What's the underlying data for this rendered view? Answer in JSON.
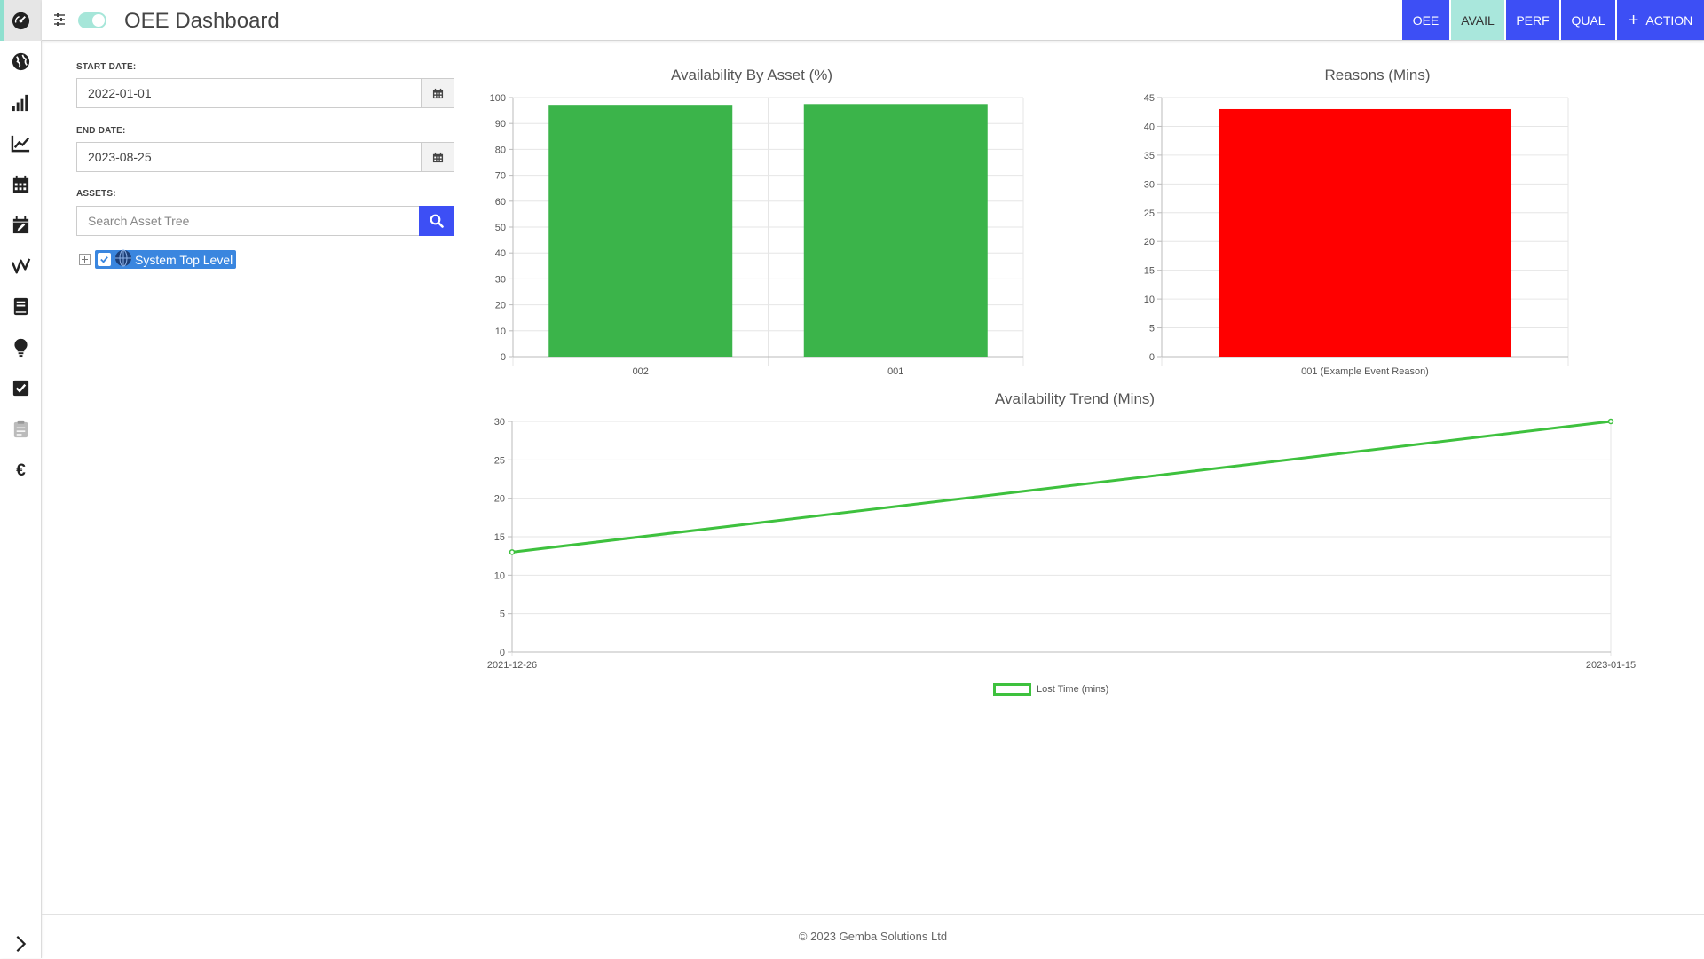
{
  "header": {
    "title": "OEE Dashboard",
    "tabs": [
      {
        "label": "OEE",
        "active": false
      },
      {
        "label": "AVAIL",
        "active": true
      },
      {
        "label": "PERF",
        "active": false
      },
      {
        "label": "QUAL",
        "active": false
      }
    ],
    "action_label": "ACTION"
  },
  "sidebar": {
    "items": [
      "dashboard-icon",
      "globe-icon",
      "signal-bars-icon",
      "line-chart-icon",
      "calendar-icon",
      "calendar-edit-icon",
      "trend-icon",
      "book-icon",
      "lightbulb-icon",
      "checkbox-icon",
      "clipboard-icon",
      "euro-icon"
    ],
    "expand_icon": "chevron-right-icon"
  },
  "filters": {
    "start_label": "START DATE:",
    "start_value": "2022-01-01",
    "end_label": "END DATE:",
    "end_value": "2023-08-25",
    "assets_label": "ASSETS:",
    "search_placeholder": "Search Asset Tree",
    "tree_root": "System Top Level"
  },
  "colors": {
    "accent": "#3d4ff5",
    "active_tab": "#a9e7dc",
    "bar_green": "#3bb44a",
    "bar_red": "#ff0000",
    "line_green": "#3ec13e",
    "tree_selected": "#3a86df"
  },
  "chart_data": [
    {
      "type": "bar",
      "title": "Availability By Asset (%)",
      "categories": [
        "002",
        "001"
      ],
      "values": [
        97.2,
        97.5
      ],
      "ylim": [
        0,
        100
      ],
      "yticks": [
        0,
        10,
        20,
        30,
        40,
        50,
        60,
        70,
        80,
        90,
        100
      ],
      "color": "#3bb44a"
    },
    {
      "type": "bar",
      "title": "Reasons (Mins)",
      "categories": [
        "001 (Example Event Reason)"
      ],
      "values": [
        43
      ],
      "ylim": [
        0,
        45
      ],
      "yticks": [
        0,
        5,
        10,
        15,
        20,
        25,
        30,
        35,
        40,
        45
      ],
      "color": "#ff0000"
    },
    {
      "type": "line",
      "title": "Availability Trend (Mins)",
      "x": [
        "2021-12-26",
        "2023-01-15"
      ],
      "series": [
        {
          "name": "Lost Time (mins)",
          "values": [
            13,
            30
          ]
        }
      ],
      "ylim": [
        0,
        30
      ],
      "yticks": [
        0,
        5,
        10,
        15,
        20,
        25,
        30
      ],
      "legend": "bottom",
      "color": "#3ec13e"
    }
  ],
  "footer": {
    "copyright": "© 2023 Gemba Solutions Ltd"
  }
}
